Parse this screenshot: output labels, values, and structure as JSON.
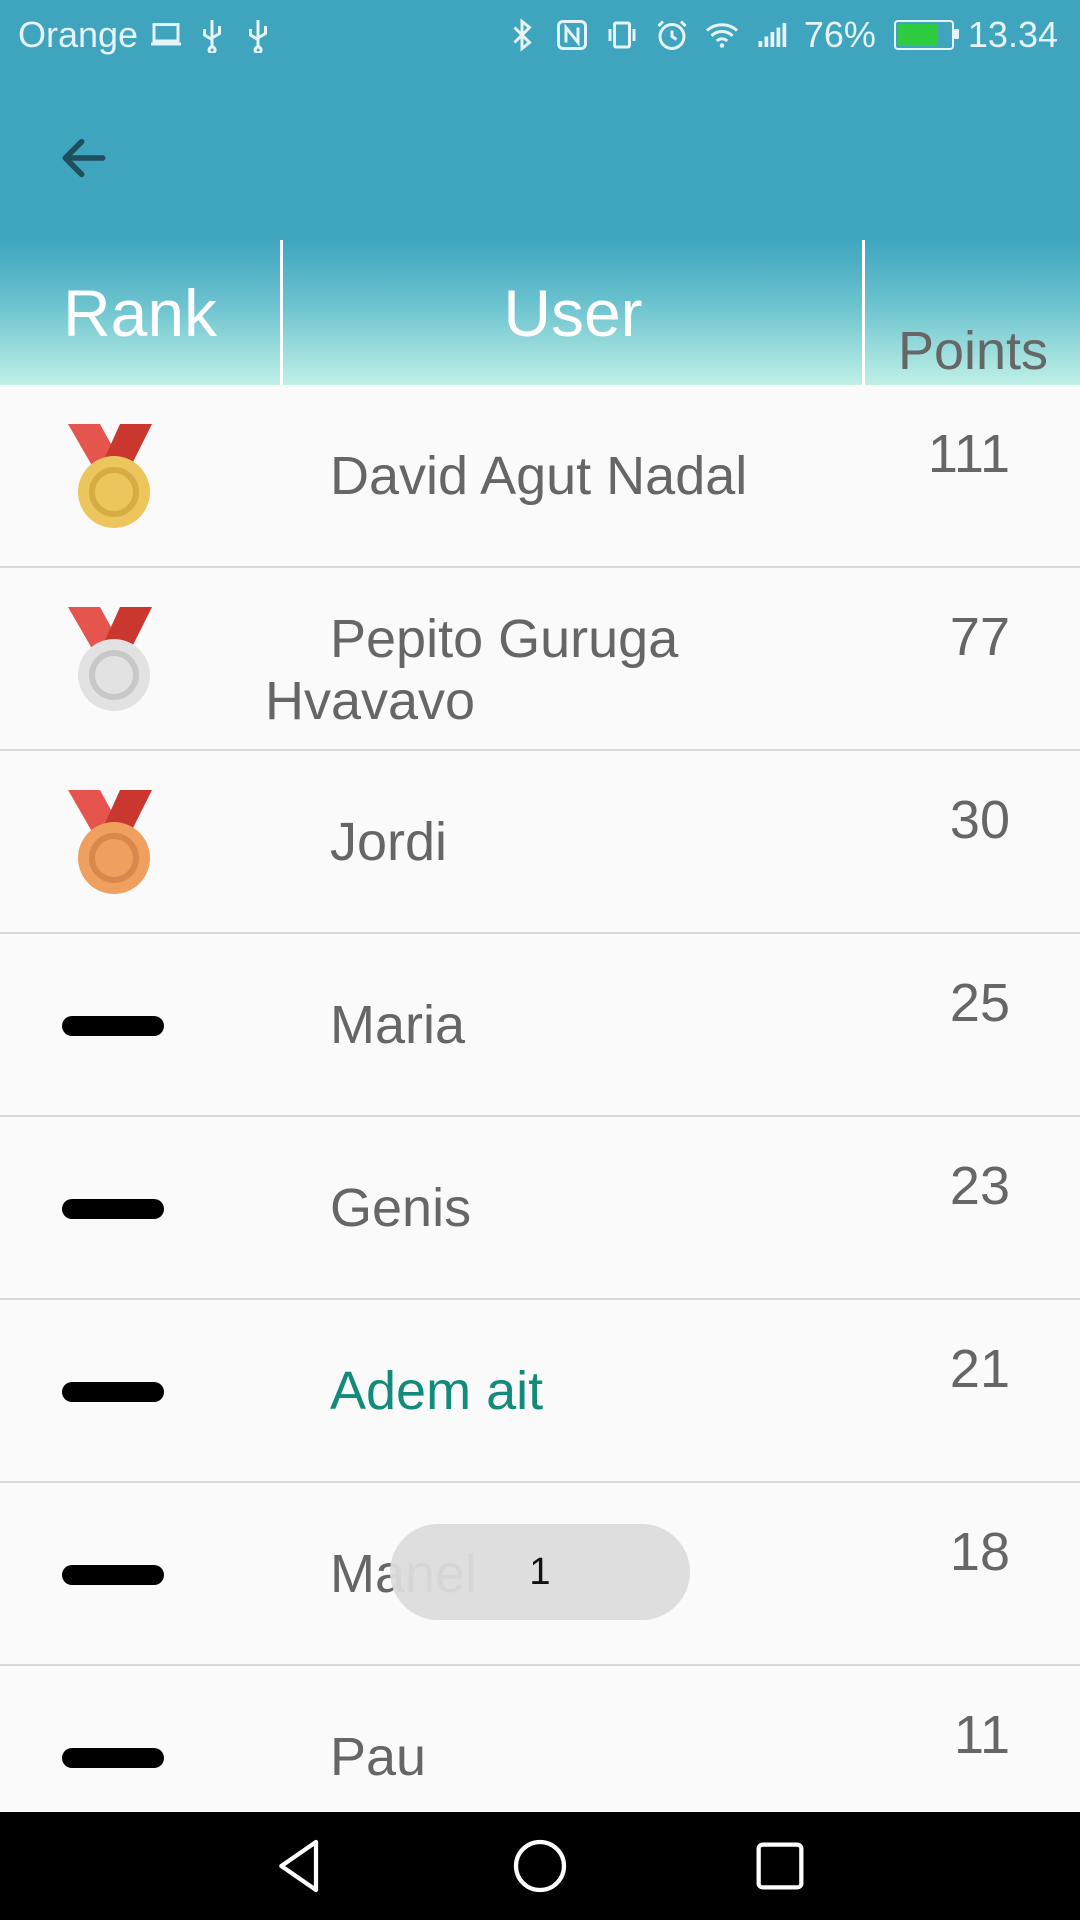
{
  "status_bar": {
    "carrier": "Orange",
    "battery_percent": "76%",
    "time": "13.34"
  },
  "app_bar": {
    "back_icon": "arrow-left-icon"
  },
  "table": {
    "headers": {
      "rank": "Rank",
      "user": "User",
      "points": "Points"
    },
    "rows": [
      {
        "rank_icon": "gold-medal-icon",
        "name": "David Agut Nadal",
        "points": "111"
      },
      {
        "rank_icon": "silver-medal-icon",
        "name": "Pepito Guruga Hvavavo",
        "points": "77"
      },
      {
        "rank_icon": "bronze-medal-icon",
        "name": "Jordi",
        "points": "30"
      },
      {
        "rank_icon": "dash-icon",
        "name": "Maria",
        "points": "25"
      },
      {
        "rank_icon": "dash-icon",
        "name": "Genis",
        "points": "23"
      },
      {
        "rank_icon": "dash-icon",
        "name": "Adem ait",
        "points": "21",
        "highlight": true
      },
      {
        "rank_icon": "dash-icon",
        "name": "Manel",
        "points": "18"
      },
      {
        "rank_icon": "dash-icon",
        "name": "Pau",
        "points": "11"
      }
    ]
  },
  "page_indicator": "1",
  "colors": {
    "primary": "#3fa5bf",
    "highlight_name": "#138b7a",
    "gold": "#ecc55c",
    "silver": "#e0e0e0",
    "bronze": "#ef9f5e",
    "ribbon": "#d6403a"
  }
}
